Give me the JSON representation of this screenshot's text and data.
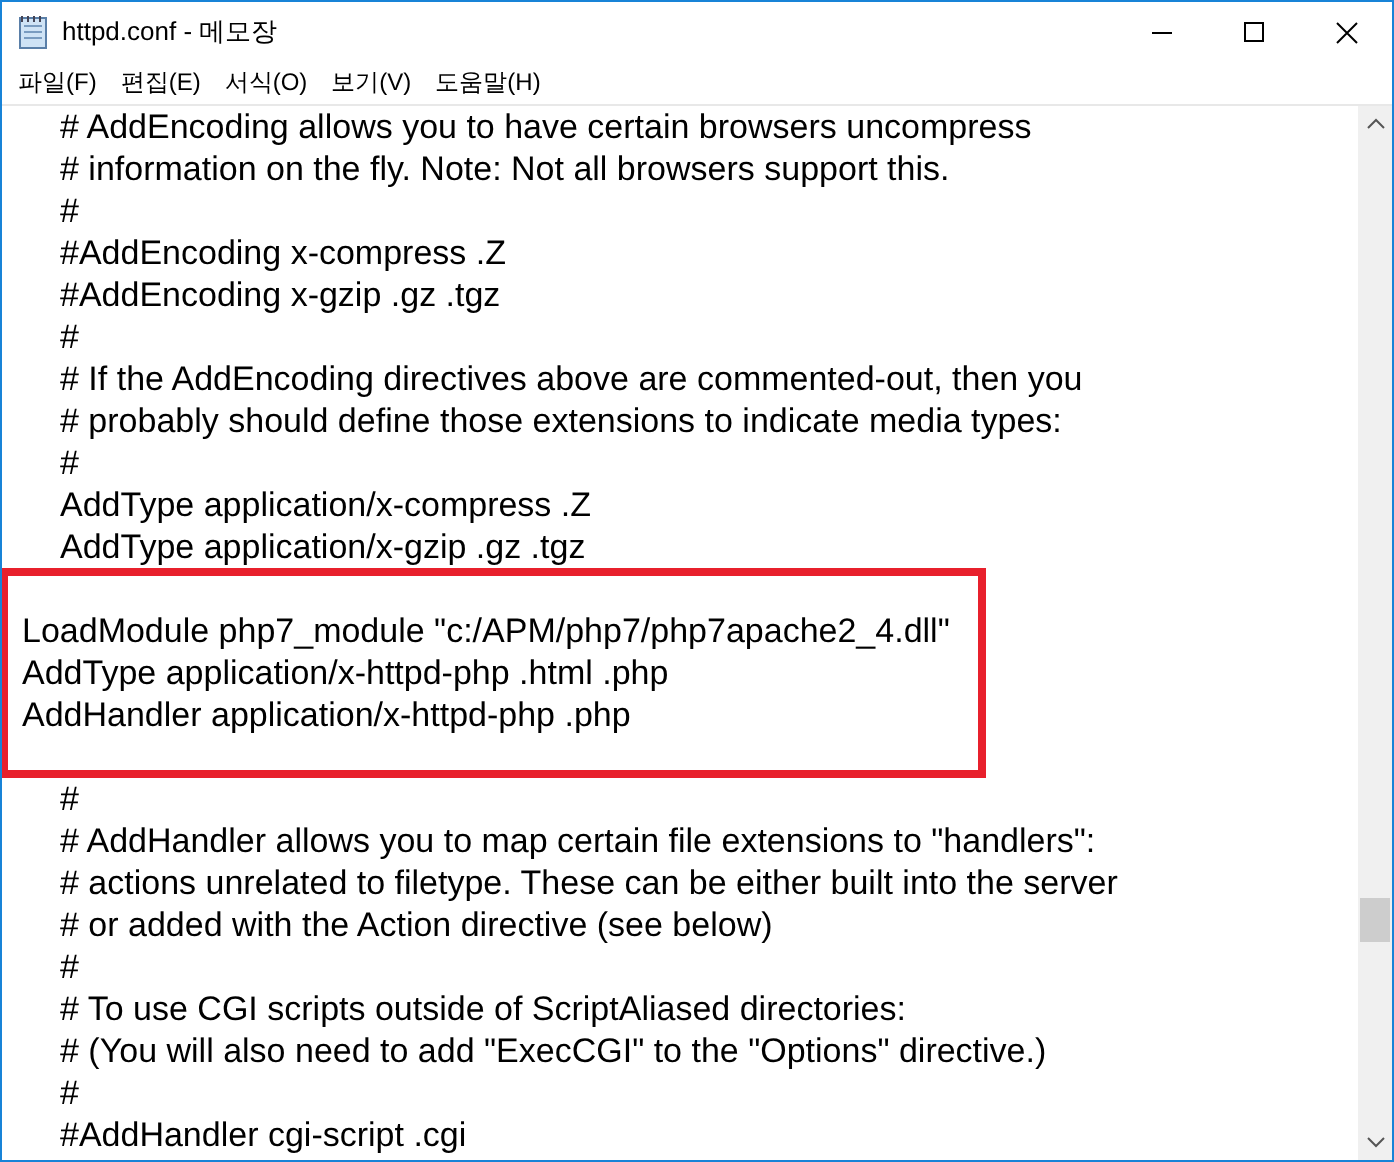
{
  "window": {
    "title": "httpd.conf - 메모장"
  },
  "menu": [
    "파일(F)",
    "편집(E)",
    "서식(O)",
    "보기(V)",
    "도움말(H)"
  ],
  "editor": {
    "lines_before": [
      {
        "text": "# AddEncoding allows you to have certain browsers uncompress",
        "indented": true
      },
      {
        "text": "# information on the fly. Note: Not all browsers support this.",
        "indented": true
      },
      {
        "text": "#",
        "indented": true
      },
      {
        "text": "#AddEncoding x-compress .Z",
        "indented": true
      },
      {
        "text": "#AddEncoding x-gzip .gz .tgz",
        "indented": true
      },
      {
        "text": "#",
        "indented": true
      },
      {
        "text": "# If the AddEncoding directives above are commented-out, then you",
        "indented": true
      },
      {
        "text": "# probably should define those extensions to indicate media types:",
        "indented": true
      },
      {
        "text": "#",
        "indented": true
      },
      {
        "text": "AddType application/x-compress .Z",
        "indented": true
      },
      {
        "text": "AddType application/x-gzip .gz .tgz",
        "indented": true
      }
    ],
    "highlighted_lines": [
      {
        "text": "LoadModule php7_module \"c:/APM/php7/php7apache2_4.dll\"",
        "indented": false
      },
      {
        "text": "AddType application/x-httpd-php .html .php",
        "indented": false
      },
      {
        "text": "AddHandler application/x-httpd-php .php",
        "indented": false
      }
    ],
    "lines_after": [
      {
        "text": "#",
        "indented": true
      },
      {
        "text": "# AddHandler allows you to map certain file extensions to \"handlers\":",
        "indented": true
      },
      {
        "text": "# actions unrelated to filetype. These can be either built into the server",
        "indented": true
      },
      {
        "text": "# or added with the Action directive (see below)",
        "indented": true
      },
      {
        "text": "#",
        "indented": true
      },
      {
        "text": "# To use CGI scripts outside of ScriptAliased directories:",
        "indented": true
      },
      {
        "text": "# (You will also need to add \"ExecCGI\" to the \"Options\" directive.)",
        "indented": true
      },
      {
        "text": "#",
        "indented": true
      },
      {
        "text": "#AddHandler cgi-script .cgi",
        "indented": true
      }
    ]
  }
}
